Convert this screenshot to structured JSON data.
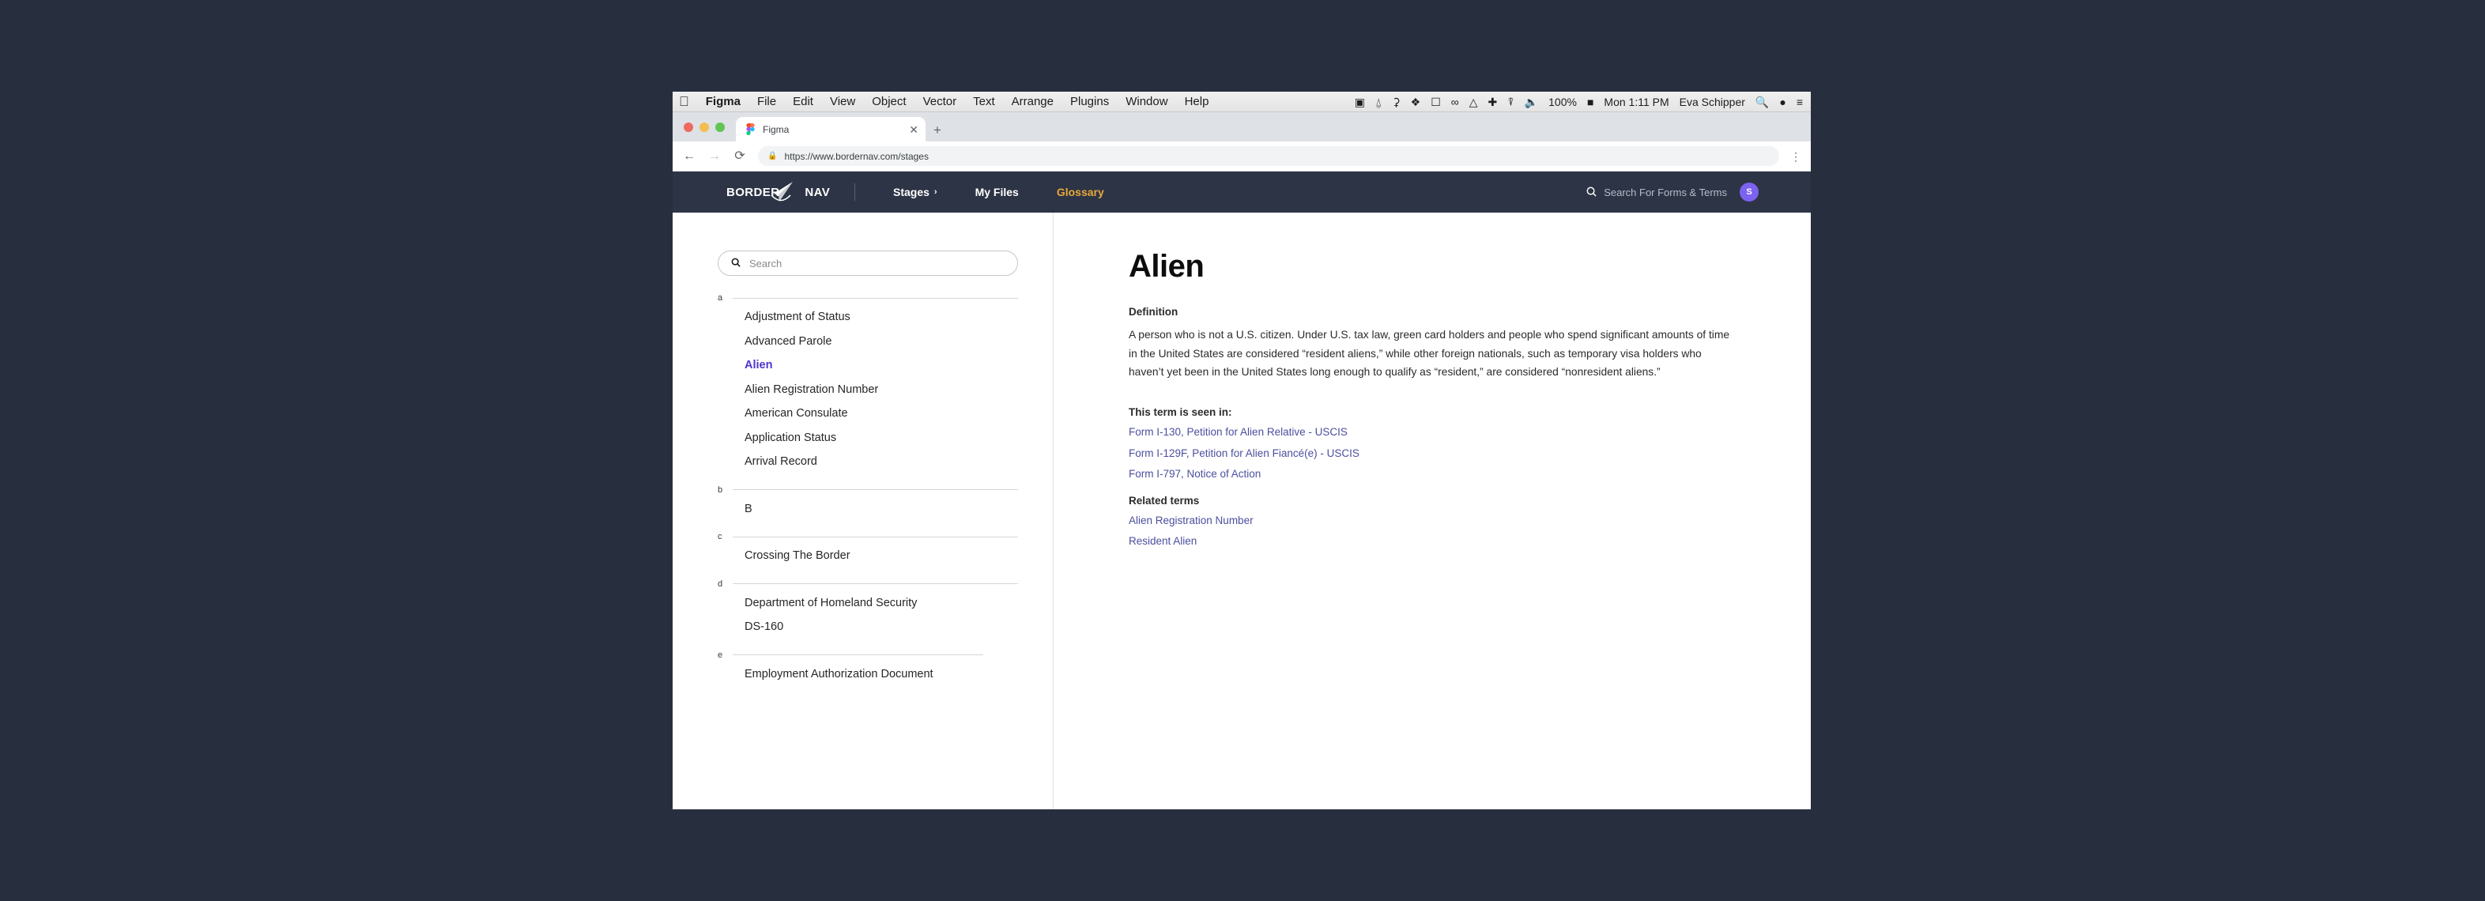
{
  "os": {
    "menubar": {
      "apple": "",
      "items": [
        "Figma",
        "File",
        "Edit",
        "View",
        "Object",
        "Vector",
        "Text",
        "Arrange",
        "Plugins",
        "Window",
        "Help"
      ],
      "status_icons": [
        "display-icon",
        "headphones-icon",
        "java-icon",
        "dropbox-icon",
        "screenshot-icon",
        "glasses-icon",
        "drive-icon",
        "crosshair-icon",
        "wifi-icon",
        "volume-icon"
      ],
      "battery": "100%",
      "battery_icon": "battery-icon",
      "clock": "Mon 1:11 PM",
      "user": "Eva Schipper",
      "spotlight_icon": "search-icon",
      "siri_icon": "siri-icon",
      "notification_icon": "list-icon"
    }
  },
  "browser": {
    "tab": {
      "title": "Figma",
      "favicon": "figma-icon",
      "close": "✕"
    },
    "new_tab": "+",
    "toolbar": {
      "back": "←",
      "forward": "→",
      "reload": "⟳",
      "lock_icon": "lock-icon",
      "url": "https://www.bordernav.com/stages",
      "menu": "⋮"
    }
  },
  "site": {
    "header": {
      "logo_left": "Border",
      "logo_right": "Nav",
      "logo_icon": "paper-plane-icon",
      "nav": [
        {
          "label": "Stages",
          "chevron": "›",
          "accent": false
        },
        {
          "label": "My Files",
          "chevron": "",
          "accent": false
        },
        {
          "label": "Glossary",
          "chevron": "",
          "accent": true
        }
      ],
      "search_icon": "search-icon",
      "search_placeholder": "Search  For Forms & Terms",
      "avatar_initial": "S",
      "avatar_color": "#7c62f0"
    },
    "sidebar": {
      "search_icon": "search-icon",
      "search_placeholder": "Search",
      "groups": [
        {
          "letter": "a",
          "terms": [
            {
              "label": "Adjustment of Status",
              "active": false
            },
            {
              "label": "Advanced Parole",
              "active": false
            },
            {
              "label": "Alien",
              "active": true
            },
            {
              "label": "Alien Registration Number",
              "active": false
            },
            {
              "label": "American Consulate",
              "active": false
            },
            {
              "label": "Application Status",
              "active": false
            },
            {
              "label": "Arrival Record",
              "active": false
            }
          ]
        },
        {
          "letter": "b",
          "terms": [
            {
              "label": "B",
              "active": false
            }
          ]
        },
        {
          "letter": "c",
          "terms": [
            {
              "label": "Crossing The Border",
              "active": false
            }
          ]
        },
        {
          "letter": "d",
          "terms": [
            {
              "label": "Department of Homeland Security",
              "active": false
            },
            {
              "label": "DS-160",
              "active": false
            }
          ]
        },
        {
          "letter": "e",
          "terms": [
            {
              "label": "Employment Authorization Document",
              "active": false
            }
          ]
        }
      ]
    },
    "main": {
      "title": "Alien",
      "definition_heading": "Definition",
      "definition": "A person who is not a U.S. citizen. Under U.S. tax law, green card holders and people who spend significant amounts of time in the United States are considered “resident aliens,” while other foreign nationals, such as temporary visa holders who haven’t yet been in the United States long enough to qualify as “resident,” are considered “nonresident aliens.”",
      "seen_in_heading": "This term is seen in:",
      "seen_in_links": [
        "Form I-130, Petition for Alien Relative - USCIS",
        "Form I-129F, Petition for Alien Fiancé(e) - USCIS",
        "Form I-797, Notice of Action"
      ],
      "related_heading": "Related terms",
      "related_links": [
        "Alien Registration Number",
        "Resident Alien"
      ]
    }
  },
  "colors": {
    "page_backdrop": "#272f3f",
    "site_header": "#2d3445",
    "accent_gold": "#e8a93a",
    "active_term": "#4b35cc",
    "link": "#4b4f9e",
    "avatar": "#7c62f0"
  }
}
